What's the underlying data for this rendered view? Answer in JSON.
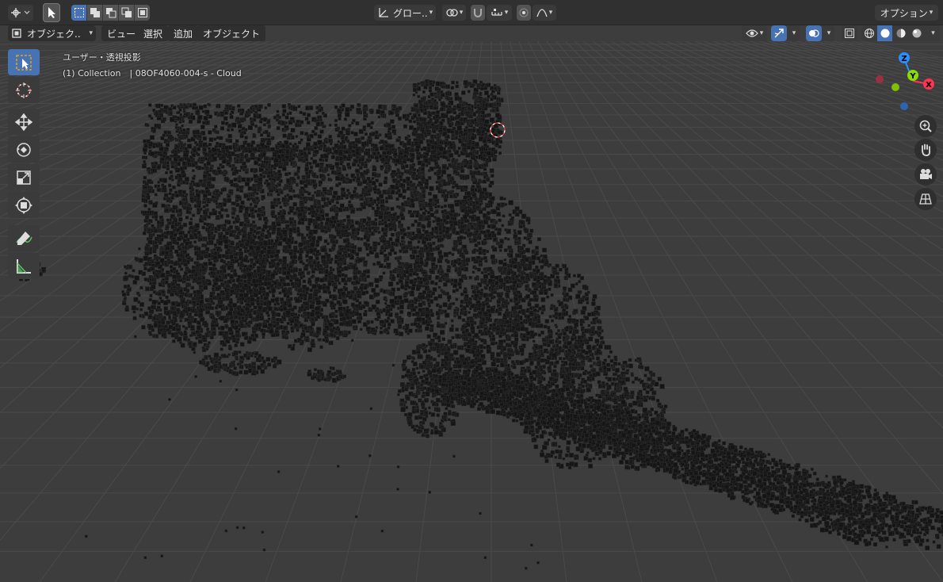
{
  "topbar": {
    "transform_orientation": "グロー..",
    "options_label": "オプション"
  },
  "header": {
    "mode_label": "オブジェク..",
    "menus": [
      "ビュー",
      "選択",
      "追加",
      "オブジェクト"
    ]
  },
  "viewport": {
    "view_label": "ユーザー・透視投影",
    "object_info": "(1) Collection　| 08OF4060-004-s - Cloud"
  },
  "gizmo": {
    "x_label": "X",
    "y_label": "Y",
    "z_label": "Z",
    "colors": {
      "x": "#ff3352",
      "y": "#8bdc00",
      "z": "#2890ff"
    }
  },
  "tools": [
    "select-box-icon",
    "cursor-icon",
    "move-icon",
    "rotate-icon",
    "scale-icon",
    "transform-icon",
    "annotate-icon",
    "measure-icon"
  ],
  "navigation": [
    "zoom-icon",
    "pan-hand-icon",
    "camera-icon",
    "ortho-grid-icon"
  ],
  "colors": {
    "accent": "#4772b3",
    "background": "#3d3d3d",
    "header": "#303030"
  }
}
